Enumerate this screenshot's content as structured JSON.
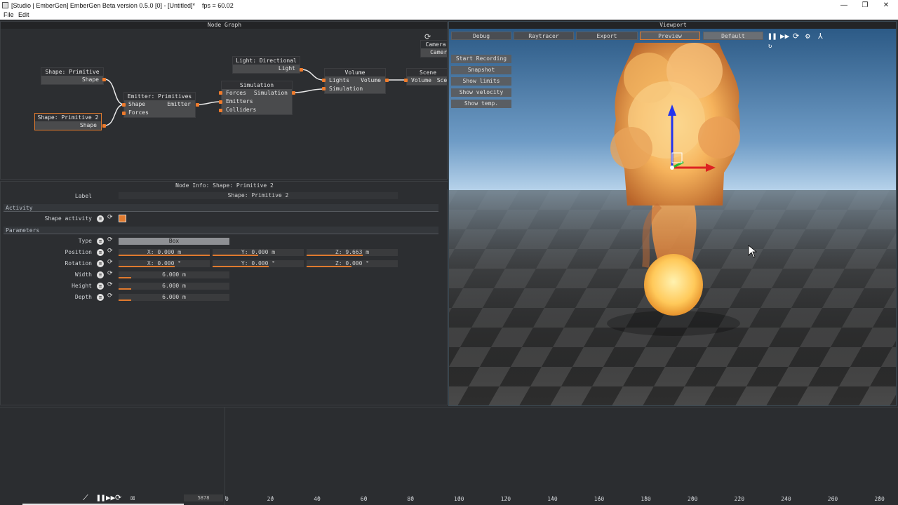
{
  "window": {
    "title": "[Studio | EmberGen] EmberGen Beta version 0.5.0 [0] - [Untitled]*    fps = 60.02",
    "minimize": "—",
    "maximize": "❐",
    "close": "✕"
  },
  "menu": {
    "file": "File",
    "edit": "Edit"
  },
  "node_graph": {
    "title": "Node Graph",
    "nodes": {
      "shape1": {
        "title": "Shape: Primitive",
        "out": "Shape"
      },
      "shape2": {
        "title": "Shape: Primitive 2",
        "out": "Shape"
      },
      "emitter": {
        "title": "Emitter: Primitives",
        "in1": "Shape",
        "in2": "Forces",
        "out": "Emitter"
      },
      "light": {
        "title": "Light: Directional",
        "out": "Light"
      },
      "simulation": {
        "title": "Simulation",
        "in1": "Forces",
        "in2": "Emitters",
        "in3": "Colliders",
        "out": "Simulation"
      },
      "volume": {
        "title": "Volume",
        "in1": "Lights",
        "in2": "Simulation",
        "out": "Volume"
      },
      "scene": {
        "title": "Scene",
        "in1": "Volume",
        "in2": "Scen"
      },
      "camera": {
        "title": "Camera",
        "out": "Camera"
      }
    }
  },
  "node_info": {
    "title": "Node Info: Shape: Primitive 2",
    "label_label": "Label",
    "label_value": "Shape: Primitive 2",
    "section_activity": "Activity",
    "shape_activity_label": "Shape activity",
    "section_parameters": "Parameters",
    "type_label": "Type",
    "type_value": "Box",
    "position_label": "Position",
    "position": {
      "x": "X: 0.000 m",
      "y": "Y: 0.000 m",
      "z": "Z: 9.663 m"
    },
    "rotation_label": "Rotation",
    "rotation": {
      "x": "X: 0.000 °",
      "y": "Y: 0.000 °",
      "z": "Z: 0.000 °"
    },
    "width_label": "Width",
    "width_value": "6.000 m",
    "height_label": "Height",
    "height_value": "6.000 m",
    "depth_label": "Depth",
    "depth_value": "6.000 m",
    "accent": "#e07a2e"
  },
  "viewport": {
    "title": "Viewport",
    "tabs": [
      "Debug",
      "Raytracer",
      "Export",
      "Preview",
      "Default"
    ],
    "buttons": [
      "Start Recording",
      "Snapshot",
      "Show limits",
      "Show velocity",
      "Show temp."
    ]
  },
  "timeline": {
    "frame": "5878",
    "ticks": [
      "0",
      "20",
      "40",
      "60",
      "80",
      "100",
      "120",
      "140",
      "160",
      "180",
      "200",
      "220",
      "240",
      "260",
      "280"
    ]
  }
}
